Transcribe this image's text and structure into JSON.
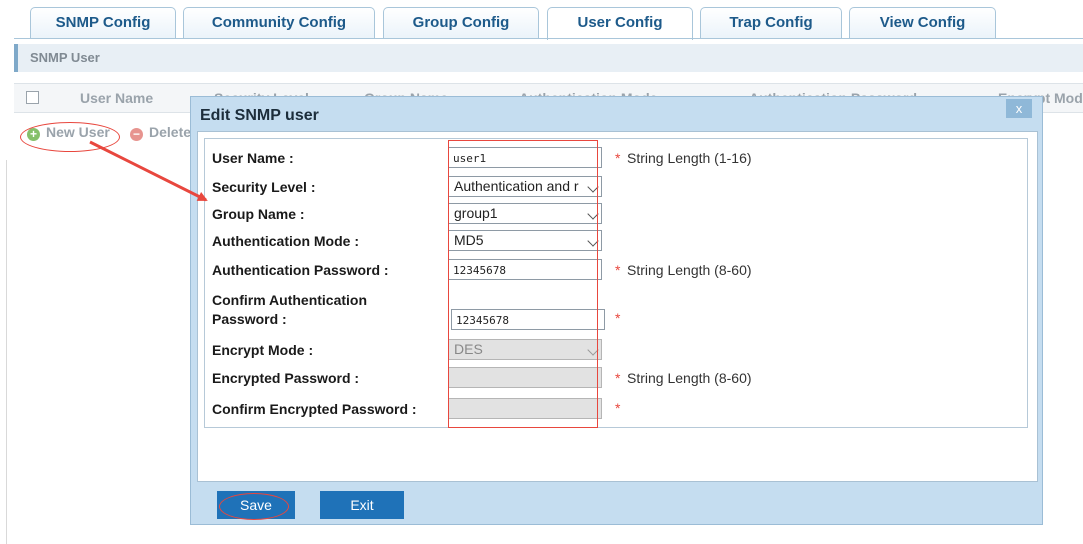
{
  "tabs": [
    {
      "label": "SNMP Config"
    },
    {
      "label": "Community Config"
    },
    {
      "label": "Group Config"
    },
    {
      "label": "User Config"
    },
    {
      "label": "Trap Config"
    },
    {
      "label": "View Config"
    }
  ],
  "active_tab": "User Config",
  "section_title": "SNMP User",
  "table": {
    "headers": [
      "User Name",
      "Security Level",
      "Group Name",
      "Authentication Mode",
      "Authentication Password",
      "Encrypt Mod"
    ]
  },
  "toolbar": {
    "new_user": "New User",
    "delete": "Delete"
  },
  "modal": {
    "title": "Edit SNMP user",
    "close": "x",
    "fields": {
      "user_name": {
        "label": "User Name :",
        "value": "user1",
        "hint": "String Length (1-16)"
      },
      "security_level": {
        "label": "Security Level :",
        "value": "Authentication and r"
      },
      "group_name": {
        "label": "Group Name :",
        "value": "group1"
      },
      "auth_mode": {
        "label": "Authentication Mode :",
        "value": "MD5"
      },
      "auth_password": {
        "label": "Authentication Password :",
        "value": "12345678",
        "hint": "String Length (8-60)"
      },
      "confirm_auth_password": {
        "label_line1": "Confirm Authentication",
        "label_line2": "Password :",
        "value": "12345678"
      },
      "encrypt_mode": {
        "label": "Encrypt Mode :",
        "value": "DES"
      },
      "encrypted_password": {
        "label": "Encrypted Password :",
        "value": "",
        "hint": "String Length (8-60)"
      },
      "confirm_encrypted_password": {
        "label": "Confirm Encrypted Password :",
        "value": ""
      }
    },
    "required_mark": "*",
    "save": "Save",
    "exit": "Exit"
  },
  "colors": {
    "accent": "#1f72b8",
    "tab_text": "#1d5a8a",
    "modal_bg": "#c5ddf0",
    "annotation_red": "#e8473e"
  }
}
